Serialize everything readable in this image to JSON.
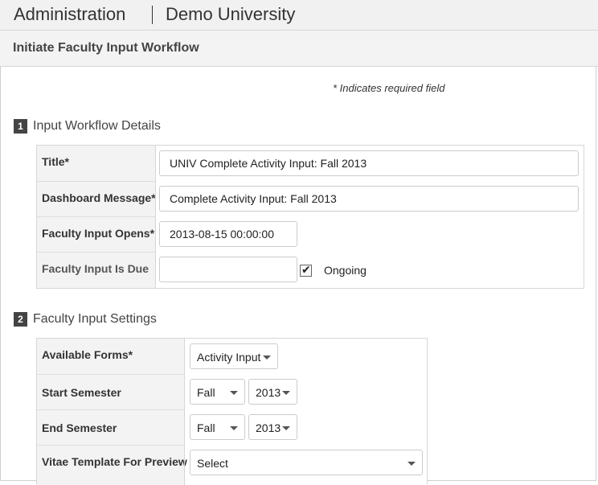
{
  "header": {
    "app_title": "Administration",
    "org_name": "Demo University"
  },
  "page": {
    "heading": "Initiate Faculty Input Workflow",
    "required_note": "* Indicates required field"
  },
  "section1": {
    "number": "1",
    "title": "Input Workflow Details",
    "fields": {
      "title": {
        "label": "Title*",
        "value": "UNIV Complete Activity Input: Fall 2013"
      },
      "dashboard_message": {
        "label": "Dashboard Message*",
        "value": "Complete Activity Input: Fall 2013"
      },
      "opens": {
        "label": "Faculty Input Opens*",
        "value": "2013-08-15 00:00:00"
      },
      "due": {
        "label": "Faculty Input Is Due",
        "value": "",
        "ongoing_label": "Ongoing",
        "ongoing_checked": true
      }
    }
  },
  "section2": {
    "number": "2",
    "title": "Faculty Input Settings",
    "fields": {
      "forms": {
        "label": "Available Forms*",
        "value": "Activity Input"
      },
      "start": {
        "label": "Start Semester",
        "term": "Fall",
        "year": "2013"
      },
      "end": {
        "label": "End Semester",
        "term": "Fall",
        "year": "2013"
      },
      "vitae": {
        "label": "Vitae Template For Preview",
        "value": "Select"
      }
    }
  },
  "icons": {
    "dropdown": "chevron-down-icon",
    "check": "checkmark-icon"
  }
}
